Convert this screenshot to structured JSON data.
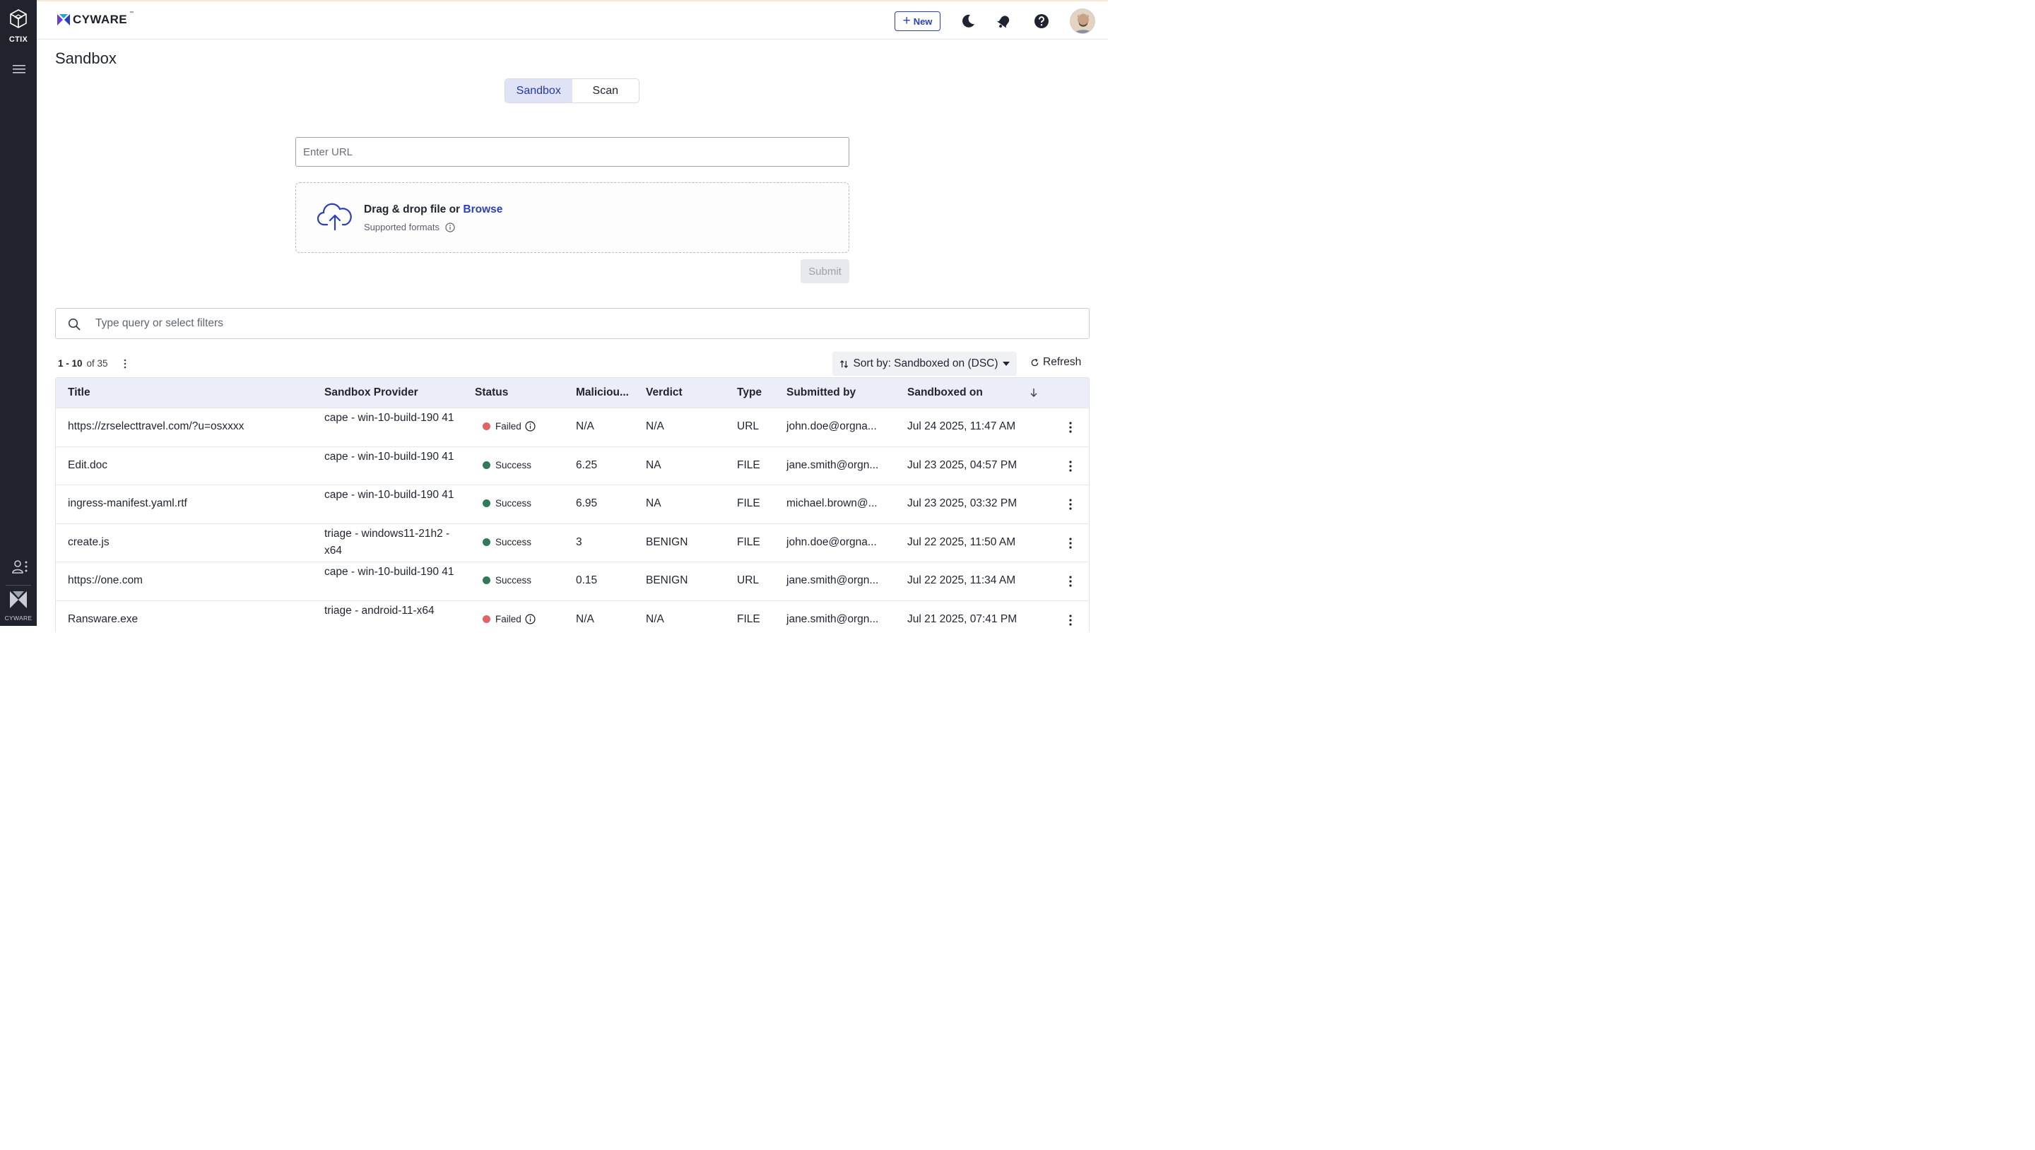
{
  "rail": {
    "product_label": "CTIX",
    "brand_label": "CYWARE"
  },
  "topbar": {
    "logo_text": "CYWARE",
    "logo_tm": "™",
    "new_button_label": "New",
    "icons": [
      "moon-icon",
      "bell-icon",
      "help-icon",
      "avatar"
    ]
  },
  "page": {
    "title": "Sandbox"
  },
  "mode_toggle": {
    "options": [
      "Sandbox",
      "Scan"
    ],
    "selected": "Sandbox"
  },
  "url_input": {
    "placeholder": "Enter URL",
    "value": ""
  },
  "upload": {
    "drag_text": "Drag & drop file or",
    "browse_label": "Browse",
    "formats_label": "Supported formats"
  },
  "submit_label": "Submit",
  "search": {
    "placeholder": "Type query or select filters"
  },
  "pagination": {
    "range": "1 - 10",
    "total": "of 35"
  },
  "sort": {
    "label": "Sort by: Sandboxed on (DSC)"
  },
  "refresh_label": "Refresh",
  "colors": {
    "accent": "#2b3fb8",
    "status_success": "#2f7a57",
    "status_failed": "#e06464",
    "rail_bg": "#20232b",
    "header_bg": "#eceef7"
  },
  "table": {
    "columns": [
      "Title",
      "Sandbox Provider",
      "Status",
      "Maliciou...",
      "Verdict",
      "Type",
      "Submitted by",
      "Sandboxed on"
    ],
    "rows": [
      {
        "title": "https://zrselecttravel.com/?u=osxxxx",
        "provider": "cape - win-10-build-190 41",
        "status": "Failed",
        "malicious": "N/A",
        "verdict": "N/A",
        "type": "URL",
        "submitted_by": "john.doe@orgna...",
        "sandboxed_on": "Jul 24 2025, 11:47 AM"
      },
      {
        "title": "Edit.doc",
        "provider": "cape - win-10-build-190 41",
        "status": "Success",
        "malicious": "6.25",
        "verdict": "NA",
        "type": "FILE",
        "submitted_by": "jane.smith@orgn...",
        "sandboxed_on": "Jul 23 2025, 04:57 PM"
      },
      {
        "title": "ingress-manifest.yaml.rtf",
        "provider": "cape - win-10-build-190 41",
        "status": "Success",
        "malicious": "6.95",
        "verdict": "NA",
        "type": "FILE",
        "submitted_by": "michael.brown@...",
        "sandboxed_on": "Jul 23 2025, 03:32 PM"
      },
      {
        "title": "create.js",
        "provider": "triage - windows11-21h2 -x64",
        "status": "Success",
        "malicious": "3",
        "verdict": "BENIGN",
        "type": "FILE",
        "submitted_by": "john.doe@orgna...",
        "sandboxed_on": "Jul 22 2025, 11:50 AM"
      },
      {
        "title": "https://one.com",
        "provider": "cape - win-10-build-190 41",
        "status": "Success",
        "malicious": "0.15",
        "verdict": "BENIGN",
        "type": "URL",
        "submitted_by": "jane.smith@orgn...",
        "sandboxed_on": "Jul 22 2025, 11:34 AM"
      },
      {
        "title": "Ransware.exe",
        "provider": "triage - android-11-x64",
        "status": "Failed",
        "malicious": "N/A",
        "verdict": "N/A",
        "type": "FILE",
        "submitted_by": "jane.smith@orgn...",
        "sandboxed_on": "Jul 21 2025, 07:41 PM"
      }
    ]
  }
}
